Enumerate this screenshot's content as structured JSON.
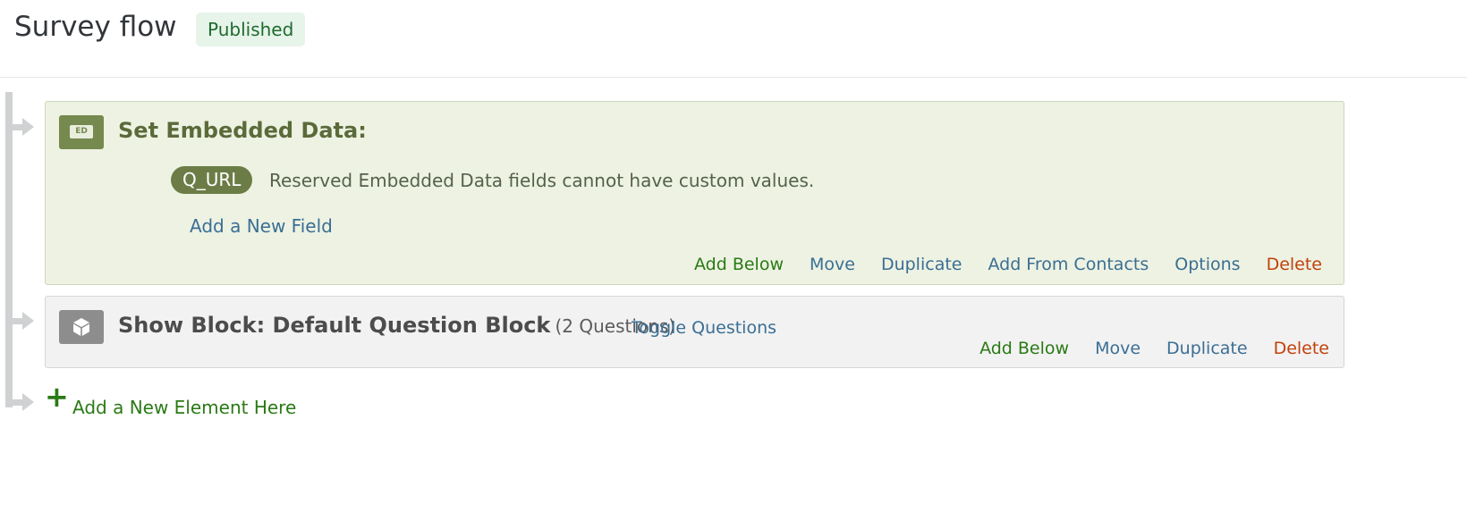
{
  "header": {
    "title": "Survey flow",
    "status": "Published"
  },
  "embedded_block": {
    "icon_text": "ED",
    "title": "Set Embedded Data:",
    "field": {
      "name": "Q_URL",
      "note": "Reserved Embedded Data fields cannot have custom values."
    },
    "add_field_label": "Add a New Field",
    "actions": {
      "add_below": "Add Below",
      "move": "Move",
      "duplicate": "Duplicate",
      "add_from_contacts": "Add From Contacts",
      "options": "Options",
      "delete": "Delete"
    }
  },
  "show_block": {
    "title": "Show Block: Default Question Block",
    "question_count": "(2 Questions)",
    "toggle_label": "Toggle Questions",
    "actions": {
      "add_below": "Add Below",
      "move": "Move",
      "duplicate": "Duplicate",
      "delete": "Delete"
    }
  },
  "add_element": {
    "plus": "+",
    "label": "Add a New Element Here"
  },
  "colors": {
    "embedded_bg": "#edf2e2",
    "embedded_accent": "#76894f",
    "block_bg": "#f2f2f2",
    "link_blue": "#3b6e94",
    "action_green": "#2a7a15",
    "action_red": "#c2410c",
    "status_bg": "#e7f4ea"
  }
}
